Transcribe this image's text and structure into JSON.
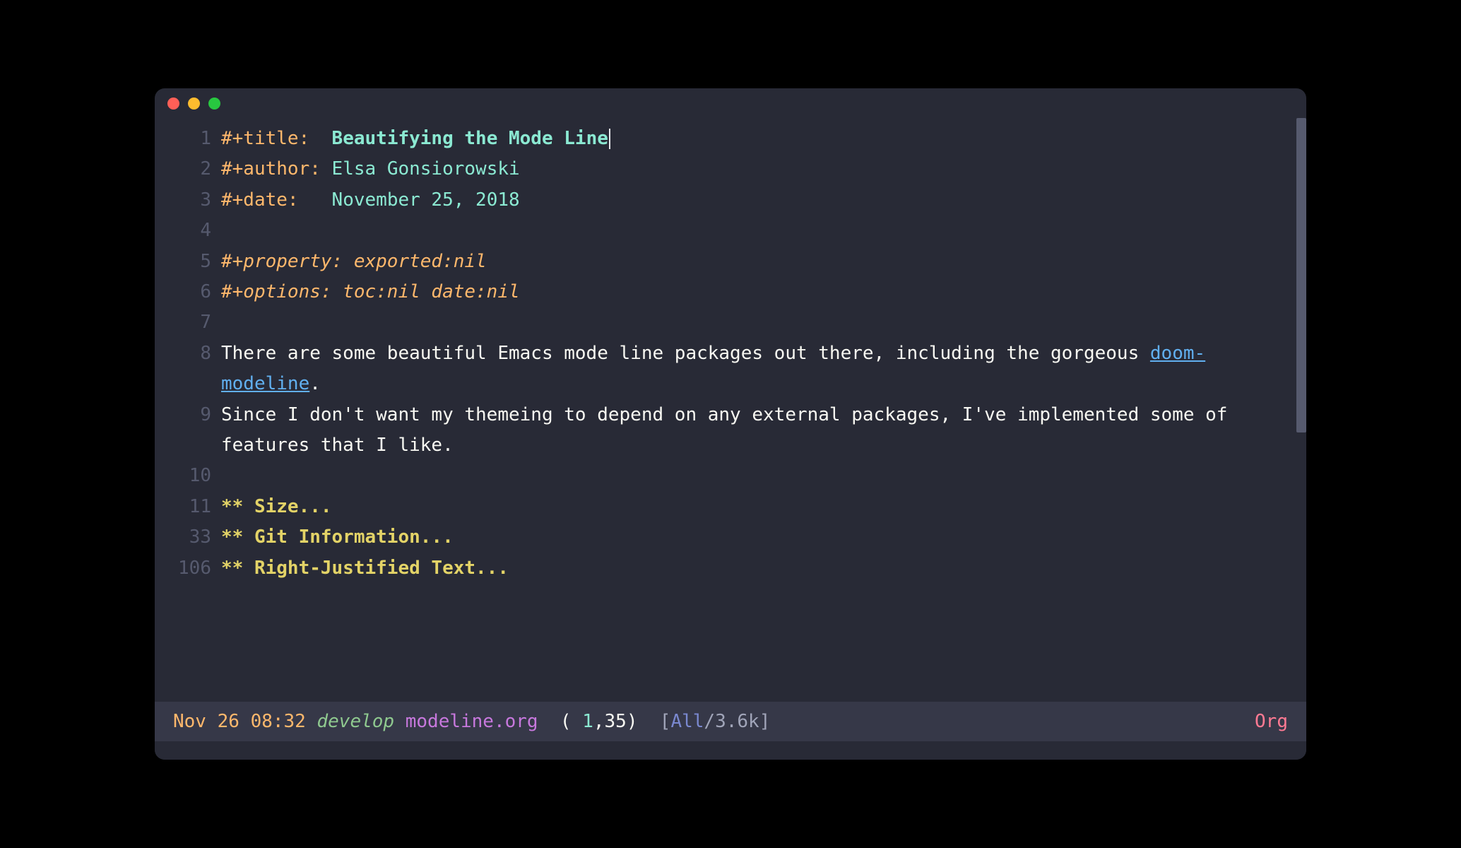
{
  "lines": [
    {
      "num": "1",
      "type": "meta-title",
      "key": "#+title:  ",
      "val": "Beautifying the Mode Line"
    },
    {
      "num": "2",
      "type": "meta",
      "key": "#+author: ",
      "val": "Elsa Gonsiorowski"
    },
    {
      "num": "3",
      "type": "meta",
      "key": "#+date:   ",
      "val": "November 25, 2018"
    },
    {
      "num": "4",
      "type": "blank"
    },
    {
      "num": "5",
      "type": "prop",
      "text": "#+property: exported:nil"
    },
    {
      "num": "6",
      "type": "prop",
      "text": "#+options: toc:nil date:nil"
    },
    {
      "num": "7",
      "type": "blank"
    },
    {
      "num": "8",
      "type": "para8"
    },
    {
      "num": "9",
      "type": "para9"
    },
    {
      "num": "10",
      "type": "blank"
    },
    {
      "num": "11",
      "type": "heading",
      "stars": "** ",
      "title": "Size..."
    },
    {
      "num": "33",
      "type": "heading",
      "stars": "** ",
      "title": "Git Information..."
    },
    {
      "num": "106",
      "type": "heading",
      "stars": "** ",
      "title": "Right-Justified Text..."
    }
  ],
  "para8": {
    "pre": "There are some beautiful Emacs mode line packages out there, including the gorgeous ",
    "link": "doom-modeline",
    "post": "."
  },
  "para9": "Since I don't want my themeing to depend on any external packages, I've implemented some of features that I like.",
  "modeline": {
    "date": "Nov 26 08:32",
    "branch": "develop",
    "file": "modeline.org",
    "line": "1",
    "col": "35",
    "pos": "All",
    "size": "3.6k",
    "mode": "Org"
  }
}
